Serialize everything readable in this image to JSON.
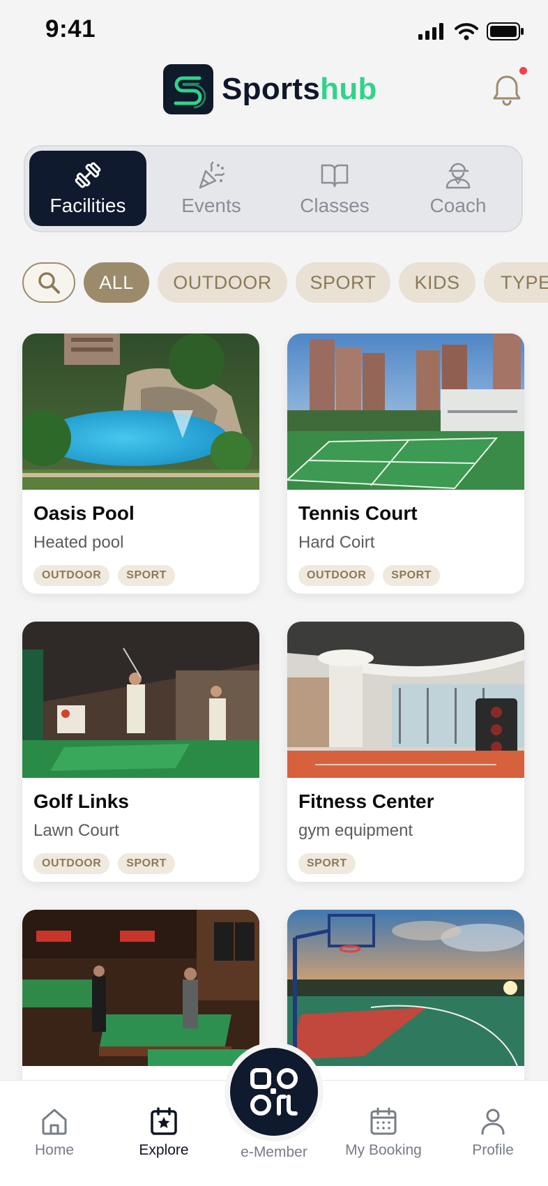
{
  "status_bar": {
    "time": "9:41"
  },
  "header": {
    "logo_part1": "Sports",
    "logo_part2": "hub",
    "brand_color": "#2fd38a",
    "notification_dot": true
  },
  "tabs": [
    {
      "label": "Facilities",
      "icon": "dumbbell-icon",
      "active": true
    },
    {
      "label": "Events",
      "icon": "party-popper-icon",
      "active": false
    },
    {
      "label": "Classes",
      "icon": "book-icon",
      "active": false
    },
    {
      "label": "Coach",
      "icon": "coach-icon",
      "active": false
    }
  ],
  "filters": {
    "search_icon": "search-icon",
    "chips": [
      "ALL",
      "OUTDOOR",
      "SPORT",
      "KIDS",
      "TYPE"
    ],
    "selected": "ALL"
  },
  "cards": [
    {
      "title": "Oasis Pool",
      "subtitle": "Heated pool",
      "tags": [
        "OUTDOOR",
        "SPORT"
      ],
      "image": "pool-photo"
    },
    {
      "title": "Tennis Court",
      "subtitle": "Hard Coirt",
      "tags": [
        "OUTDOOR",
        "SPORT"
      ],
      "image": "tennis-photo"
    },
    {
      "title": "Golf Links",
      "subtitle": "Lawn Court",
      "tags": [
        "OUTDOOR",
        "SPORT"
      ],
      "image": "golf-photo"
    },
    {
      "title": "Fitness Center",
      "subtitle": "gym equipment",
      "tags": [
        "SPORT"
      ],
      "image": "gym-photo"
    },
    {
      "image": "billiards-photo"
    },
    {
      "image": "basketball-photo"
    }
  ],
  "bottom_nav": [
    {
      "label": "Home",
      "icon": "home-icon",
      "active": false
    },
    {
      "label": "Explore",
      "icon": "explore-icon",
      "active": true
    },
    {
      "label": "e-Member",
      "icon": "qr-code-icon",
      "active": false
    },
    {
      "label": "My Booking",
      "icon": "calendar-icon",
      "active": false
    },
    {
      "label": "Profile",
      "icon": "profile-icon",
      "active": false
    }
  ],
  "colors": {
    "navy": "#101a2e",
    "accent_gold": "#9c8b6b",
    "chip_bg": "#e8e1d4",
    "notification": "#f0424e"
  }
}
